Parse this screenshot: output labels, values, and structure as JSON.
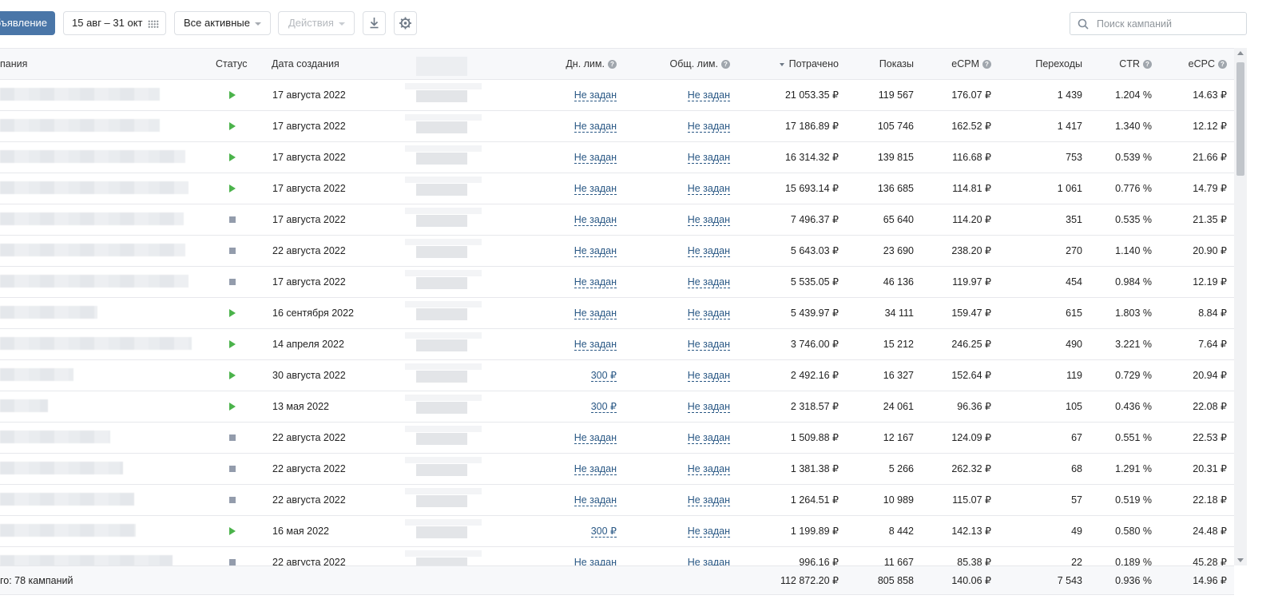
{
  "toolbar": {
    "create_button": "бъявление",
    "date_range": "15 авг – 31 окт",
    "filter": "Все активные",
    "actions": "Действия",
    "download_icon": "download-icon",
    "settings_icon": "gear-icon",
    "search_placeholder": "Поиск кампаний"
  },
  "columns": {
    "name": "пания",
    "status": "Статус",
    "created": "Дата создания",
    "daily_limit": "Дн. лим.",
    "total_limit": "Общ. лим.",
    "spent": "Потрачено",
    "impressions": "Показы",
    "ecpm": "eCPM",
    "clicks": "Переходы",
    "ctr": "CTR",
    "ecpc": "eCPC"
  },
  "rows": [
    {
      "status": "active",
      "created": "17 августа 2022",
      "daily": "Не задан",
      "total": "Не задан",
      "spent": "21 053.35 ₽",
      "impressions": "119 567",
      "ecpm": "176.07 ₽",
      "clicks": "1 439",
      "ctr": "1.204 %",
      "ecpc": "14.63 ₽"
    },
    {
      "status": "active",
      "created": "17 августа 2022",
      "daily": "Не задан",
      "total": "Не задан",
      "spent": "17 186.89 ₽",
      "impressions": "105 746",
      "ecpm": "162.52 ₽",
      "clicks": "1 417",
      "ctr": "1.340 %",
      "ecpc": "12.12 ₽"
    },
    {
      "status": "active",
      "created": "17 августа 2022",
      "daily": "Не задан",
      "total": "Не задан",
      "spent": "16 314.32 ₽",
      "impressions": "139 815",
      "ecpm": "116.68 ₽",
      "clicks": "753",
      "ctr": "0.539 %",
      "ecpc": "21.66 ₽"
    },
    {
      "status": "active",
      "created": "17 августа 2022",
      "daily": "Не задан",
      "total": "Не задан",
      "spent": "15 693.14 ₽",
      "impressions": "136 685",
      "ecpm": "114.81 ₽",
      "clicks": "1 061",
      "ctr": "0.776 %",
      "ecpc": "14.79 ₽"
    },
    {
      "status": "stopped",
      "created": "17 августа 2022",
      "daily": "Не задан",
      "total": "Не задан",
      "spent": "7 496.37 ₽",
      "impressions": "65 640",
      "ecpm": "114.20 ₽",
      "clicks": "351",
      "ctr": "0.535 %",
      "ecpc": "21.35 ₽"
    },
    {
      "status": "stopped",
      "created": "22 августа 2022",
      "daily": "Не задан",
      "total": "Не задан",
      "spent": "5 643.03 ₽",
      "impressions": "23 690",
      "ecpm": "238.20 ₽",
      "clicks": "270",
      "ctr": "1.140 %",
      "ecpc": "20.90 ₽"
    },
    {
      "status": "stopped",
      "created": "17 августа 2022",
      "daily": "Не задан",
      "total": "Не задан",
      "spent": "5 535.05 ₽",
      "impressions": "46 136",
      "ecpm": "119.97 ₽",
      "clicks": "454",
      "ctr": "0.984 %",
      "ecpc": "12.19 ₽"
    },
    {
      "status": "active",
      "created": "16 сентября 2022",
      "daily": "Не задан",
      "total": "Не задан",
      "spent": "5 439.97 ₽",
      "impressions": "34 111",
      "ecpm": "159.47 ₽",
      "clicks": "615",
      "ctr": "1.803 %",
      "ecpc": "8.84 ₽"
    },
    {
      "status": "active",
      "created": "14 апреля 2022",
      "daily": "Не задан",
      "total": "Не задан",
      "spent": "3 746.00 ₽",
      "impressions": "15 212",
      "ecpm": "246.25 ₽",
      "clicks": "490",
      "ctr": "3.221 %",
      "ecpc": "7.64 ₽"
    },
    {
      "status": "active",
      "created": "30 августа 2022",
      "daily": "300 ₽",
      "total": "Не задан",
      "spent": "2 492.16 ₽",
      "impressions": "16 327",
      "ecpm": "152.64 ₽",
      "clicks": "119",
      "ctr": "0.729 %",
      "ecpc": "20.94 ₽"
    },
    {
      "status": "active",
      "created": "13 мая 2022",
      "daily": "300 ₽",
      "total": "Не задан",
      "spent": "2 318.57 ₽",
      "impressions": "24 061",
      "ecpm": "96.36 ₽",
      "clicks": "105",
      "ctr": "0.436 %",
      "ecpc": "22.08 ₽"
    },
    {
      "status": "stopped",
      "created": "22 августа 2022",
      "daily": "Не задан",
      "total": "Не задан",
      "spent": "1 509.88 ₽",
      "impressions": "12 167",
      "ecpm": "124.09 ₽",
      "clicks": "67",
      "ctr": "0.551 %",
      "ecpc": "22.53 ₽"
    },
    {
      "status": "stopped",
      "created": "22 августа 2022",
      "daily": "Не задан",
      "total": "Не задан",
      "spent": "1 381.38 ₽",
      "impressions": "5 266",
      "ecpm": "262.32 ₽",
      "clicks": "68",
      "ctr": "1.291 %",
      "ecpc": "20.31 ₽"
    },
    {
      "status": "stopped",
      "created": "22 августа 2022",
      "daily": "Не задан",
      "total": "Не задан",
      "spent": "1 264.51 ₽",
      "impressions": "10 989",
      "ecpm": "115.07 ₽",
      "clicks": "57",
      "ctr": "0.519 %",
      "ecpc": "22.18 ₽"
    },
    {
      "status": "active",
      "created": "16 мая 2022",
      "daily": "300 ₽",
      "total": "Не задан",
      "spent": "1 199.89 ₽",
      "impressions": "8 442",
      "ecpm": "142.13 ₽",
      "clicks": "49",
      "ctr": "0.580 %",
      "ecpc": "24.48 ₽"
    },
    {
      "status": "stopped",
      "created": "22 августа 2022",
      "daily": "Не задан",
      "total": "Не задан",
      "spent": "996.16 ₽",
      "impressions": "11 667",
      "ecpm": "85.38 ₽",
      "clicks": "22",
      "ctr": "0.189 %",
      "ecpc": "45.28 ₽"
    }
  ],
  "footer": {
    "label": "го: 78 кампаний",
    "spent": "112 872.20 ₽",
    "impressions": "805 858",
    "ecpm": "140.06 ₽",
    "clicks": "7 543",
    "ctr": "0.936 %",
    "ecpc": "14.96 ₽"
  },
  "colors": {
    "primary": "#4a76a8",
    "link": "#2a5885",
    "status_active": "#4bb34b",
    "status_stopped": "#939cac"
  }
}
